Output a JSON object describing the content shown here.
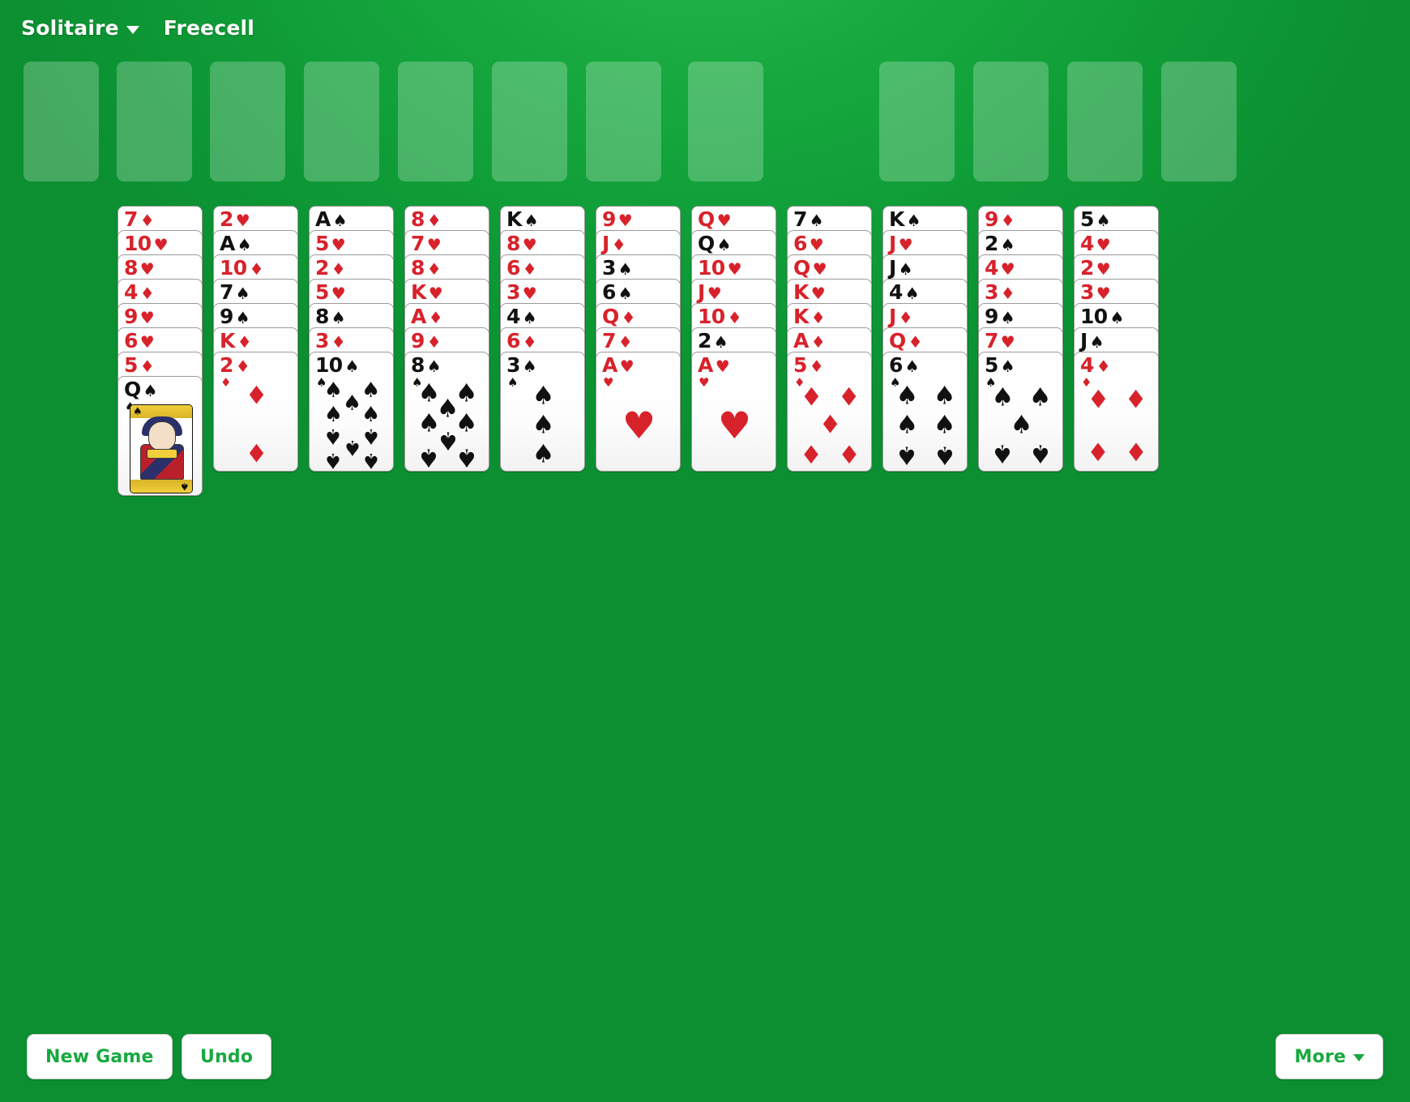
{
  "app": {
    "title": "Solitaire",
    "game_mode": "Freecell",
    "background_color": "#17a93f",
    "card_red": "#d8222b",
    "card_black": "#111111"
  },
  "header": {
    "menu_label": "Solitaire",
    "menu_caret": "chevron-down-icon",
    "game_label": "Freecell"
  },
  "free_cells": {
    "count": 4,
    "cards": [
      null,
      null,
      null,
      null
    ],
    "empty": true
  },
  "extra_cells": {
    "count": 4,
    "cards": [
      null,
      null,
      null,
      null
    ],
    "empty": true
  },
  "foundations": {
    "count": 4,
    "cards": [
      null,
      null,
      null,
      null
    ],
    "empty": true
  },
  "tableau": {
    "column_count": 11,
    "columns": [
      {
        "index": 1,
        "cards": [
          {
            "rank": "7",
            "suit": "♦",
            "color": "red"
          },
          {
            "rank": "10",
            "suit": "♥",
            "color": "red"
          },
          {
            "rank": "8",
            "suit": "♥",
            "color": "red"
          },
          {
            "rank": "4",
            "suit": "♦",
            "color": "red"
          },
          {
            "rank": "9",
            "suit": "♥",
            "color": "red"
          },
          {
            "rank": "6",
            "suit": "♥",
            "color": "red"
          },
          {
            "rank": "5",
            "suit": "♦",
            "color": "red"
          },
          {
            "rank": "Q",
            "suit": "♠",
            "color": "black",
            "face": true
          }
        ]
      },
      {
        "index": 2,
        "cards": [
          {
            "rank": "2",
            "suit": "♥",
            "color": "red"
          },
          {
            "rank": "A",
            "suit": "♠",
            "color": "black"
          },
          {
            "rank": "10",
            "suit": "♦",
            "color": "red"
          },
          {
            "rank": "7",
            "suit": "♠",
            "color": "black"
          },
          {
            "rank": "9",
            "suit": "♠",
            "color": "black"
          },
          {
            "rank": "K",
            "suit": "♦",
            "color": "red"
          },
          {
            "rank": "2",
            "suit": "♦",
            "color": "red"
          }
        ]
      },
      {
        "index": 3,
        "cards": [
          {
            "rank": "A",
            "suit": "♠",
            "color": "black"
          },
          {
            "rank": "5",
            "suit": "♥",
            "color": "red"
          },
          {
            "rank": "2",
            "suit": "♦",
            "color": "red"
          },
          {
            "rank": "5",
            "suit": "♥",
            "color": "red"
          },
          {
            "rank": "8",
            "suit": "♠",
            "color": "black"
          },
          {
            "rank": "3",
            "suit": "♦",
            "color": "red"
          },
          {
            "rank": "10",
            "suit": "♠",
            "color": "black"
          }
        ]
      },
      {
        "index": 4,
        "cards": [
          {
            "rank": "8",
            "suit": "♦",
            "color": "red"
          },
          {
            "rank": "7",
            "suit": "♥",
            "color": "red"
          },
          {
            "rank": "8",
            "suit": "♦",
            "color": "red"
          },
          {
            "rank": "K",
            "suit": "♥",
            "color": "red"
          },
          {
            "rank": "A",
            "suit": "♦",
            "color": "red"
          },
          {
            "rank": "9",
            "suit": "♦",
            "color": "red"
          },
          {
            "rank": "8",
            "suit": "♠",
            "color": "black"
          }
        ]
      },
      {
        "index": 5,
        "cards": [
          {
            "rank": "K",
            "suit": "♠",
            "color": "black"
          },
          {
            "rank": "8",
            "suit": "♥",
            "color": "red"
          },
          {
            "rank": "6",
            "suit": "♦",
            "color": "red"
          },
          {
            "rank": "3",
            "suit": "♥",
            "color": "red"
          },
          {
            "rank": "4",
            "suit": "♠",
            "color": "black"
          },
          {
            "rank": "6",
            "suit": "♦",
            "color": "red"
          },
          {
            "rank": "3",
            "suit": "♠",
            "color": "black"
          }
        ]
      },
      {
        "index": 6,
        "cards": [
          {
            "rank": "9",
            "suit": "♥",
            "color": "red"
          },
          {
            "rank": "J",
            "suit": "♦",
            "color": "red"
          },
          {
            "rank": "3",
            "suit": "♠",
            "color": "black"
          },
          {
            "rank": "6",
            "suit": "♠",
            "color": "black"
          },
          {
            "rank": "Q",
            "suit": "♦",
            "color": "red"
          },
          {
            "rank": "7",
            "suit": "♦",
            "color": "red"
          },
          {
            "rank": "A",
            "suit": "♥",
            "color": "red"
          }
        ]
      },
      {
        "index": 7,
        "cards": [
          {
            "rank": "Q",
            "suit": "♥",
            "color": "red"
          },
          {
            "rank": "Q",
            "suit": "♠",
            "color": "black"
          },
          {
            "rank": "10",
            "suit": "♥",
            "color": "red"
          },
          {
            "rank": "J",
            "suit": "♥",
            "color": "red"
          },
          {
            "rank": "10",
            "suit": "♦",
            "color": "red"
          },
          {
            "rank": "2",
            "suit": "♠",
            "color": "black"
          },
          {
            "rank": "A",
            "suit": "♥",
            "color": "red"
          }
        ]
      },
      {
        "index": 8,
        "cards": [
          {
            "rank": "7",
            "suit": "♠",
            "color": "black"
          },
          {
            "rank": "6",
            "suit": "♥",
            "color": "red"
          },
          {
            "rank": "Q",
            "suit": "♥",
            "color": "red"
          },
          {
            "rank": "K",
            "suit": "♥",
            "color": "red"
          },
          {
            "rank": "K",
            "suit": "♦",
            "color": "red"
          },
          {
            "rank": "A",
            "suit": "♦",
            "color": "red"
          },
          {
            "rank": "5",
            "suit": "♦",
            "color": "red"
          }
        ]
      },
      {
        "index": 9,
        "cards": [
          {
            "rank": "K",
            "suit": "♠",
            "color": "black"
          },
          {
            "rank": "J",
            "suit": "♥",
            "color": "red"
          },
          {
            "rank": "J",
            "suit": "♠",
            "color": "black"
          },
          {
            "rank": "4",
            "suit": "♠",
            "color": "black"
          },
          {
            "rank": "J",
            "suit": "♦",
            "color": "red"
          },
          {
            "rank": "Q",
            "suit": "♦",
            "color": "red"
          },
          {
            "rank": "6",
            "suit": "♠",
            "color": "black"
          }
        ]
      },
      {
        "index": 10,
        "cards": [
          {
            "rank": "9",
            "suit": "♦",
            "color": "red"
          },
          {
            "rank": "2",
            "suit": "♠",
            "color": "black"
          },
          {
            "rank": "4",
            "suit": "♥",
            "color": "red"
          },
          {
            "rank": "3",
            "suit": "♦",
            "color": "red"
          },
          {
            "rank": "9",
            "suit": "♠",
            "color": "black"
          },
          {
            "rank": "7",
            "suit": "♥",
            "color": "red"
          },
          {
            "rank": "5",
            "suit": "♠",
            "color": "black"
          }
        ]
      },
      {
        "index": 11,
        "cards": [
          {
            "rank": "5",
            "suit": "♠",
            "color": "black"
          },
          {
            "rank": "4",
            "suit": "♥",
            "color": "red"
          },
          {
            "rank": "2",
            "suit": "♥",
            "color": "red"
          },
          {
            "rank": "3",
            "suit": "♥",
            "color": "red"
          },
          {
            "rank": "10",
            "suit": "♠",
            "color": "black"
          },
          {
            "rank": "J",
            "suit": "♠",
            "color": "black"
          },
          {
            "rank": "4",
            "suit": "♦",
            "color": "red"
          }
        ]
      }
    ]
  },
  "footer": {
    "new_game_label": "New Game",
    "undo_label": "Undo",
    "more_label": "More",
    "more_caret": "chevron-down-icon"
  }
}
